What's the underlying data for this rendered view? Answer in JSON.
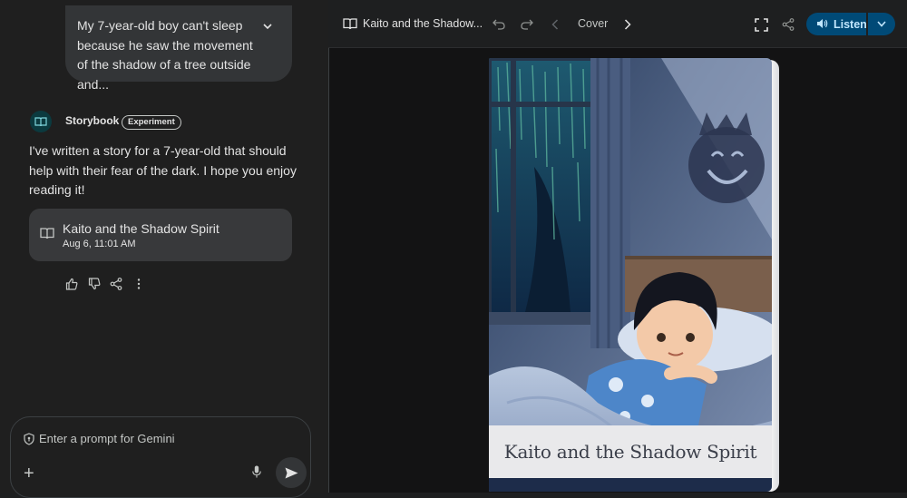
{
  "chat": {
    "user_prompt": "My 7-year-old boy can't sleep because he saw the movement of the shadow of a tree outside and...",
    "agent_name": "Storybook",
    "agent_badge": "Experiment",
    "response_text": "I've written a story for a 7-year-old that should help with their fear of the dark. I hope you enjoy reading it!",
    "story_card": {
      "title": "Kaito and the Shadow Spirit",
      "date": "Aug 6, 11:01 AM"
    },
    "actions": [
      "thumb-up-icon",
      "thumb-down-icon",
      "share-icon",
      "more-vert-icon"
    ],
    "input": {
      "placeholder": "Enter a prompt for Gemini"
    }
  },
  "viewer": {
    "title": "Kaito and the Shadow...",
    "page_label": "Cover",
    "listen_label": "Listen",
    "cover_title": "Kaito and the Shadow Spirit"
  },
  "colors": {
    "left_bg": "#1f1f1f",
    "right_bg": "#131314",
    "accent": "#004a77",
    "accent_text": "#c2e7ff"
  }
}
